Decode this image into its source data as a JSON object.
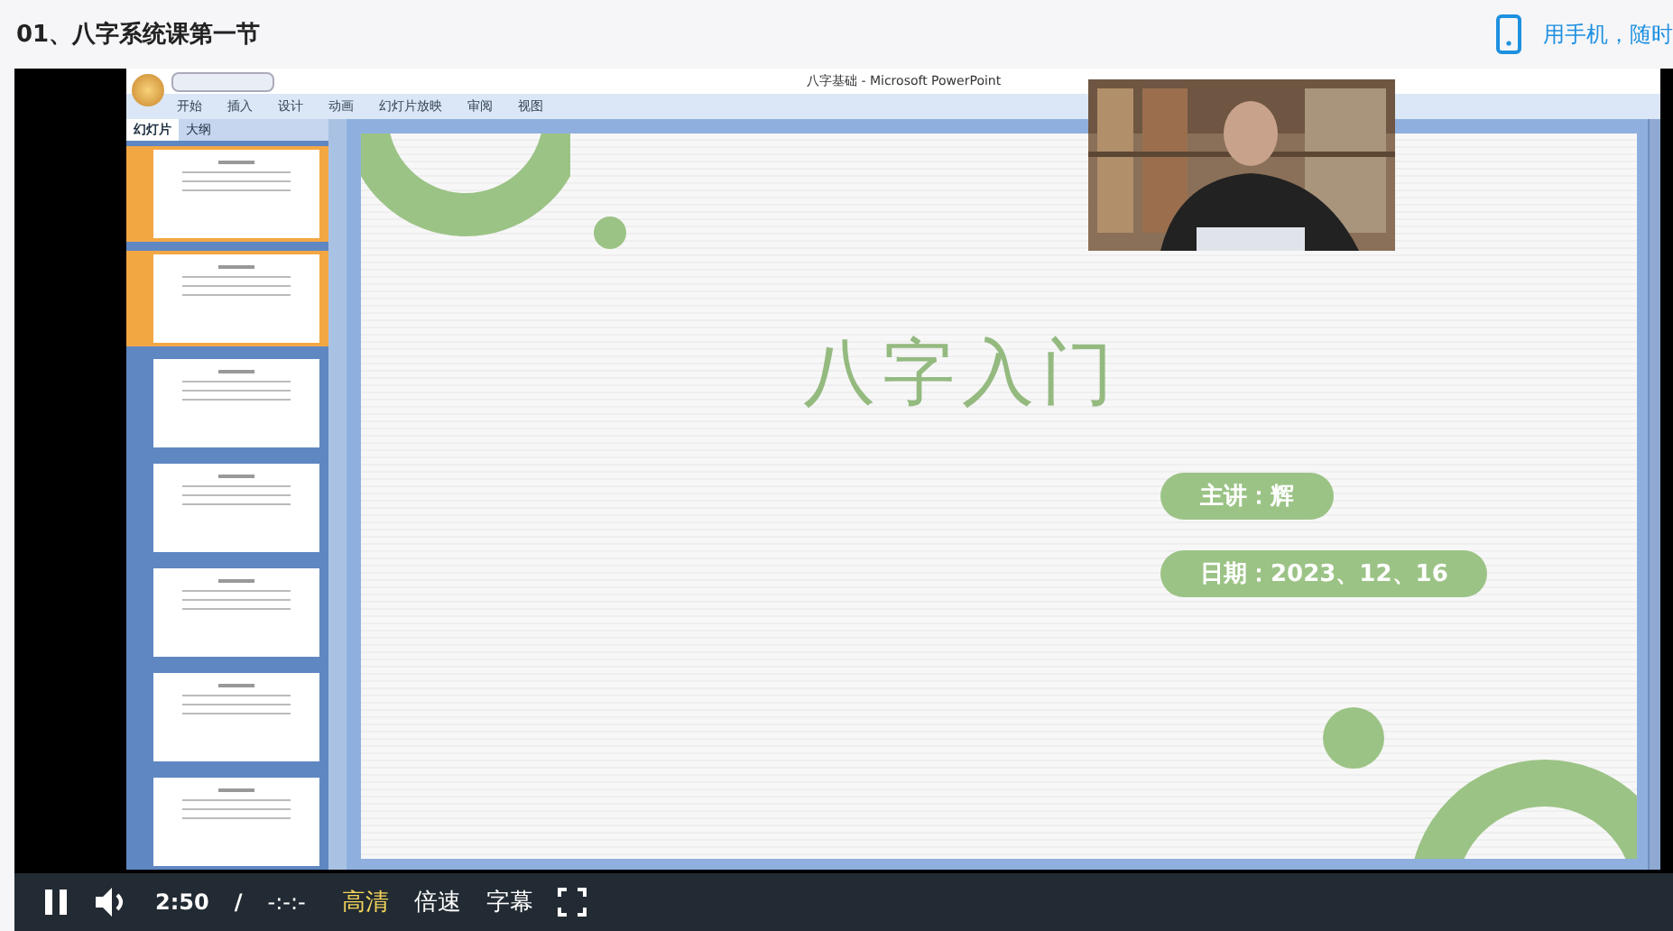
{
  "page_title": "01、八字系统课第一节",
  "mobile_link": "用手机，随时",
  "ppt": {
    "title": "八字基础 - Microsoft PowerPoint",
    "ribbon_tabs": [
      "开始",
      "插入",
      "设计",
      "动画",
      "幻灯片放映",
      "审阅",
      "视图"
    ],
    "panel_tabs": [
      {
        "label": "幻灯片",
        "selected": true
      },
      {
        "label": "大纲",
        "selected": false
      }
    ],
    "thumbnails": [
      {
        "selected": true
      },
      {
        "selected": true
      },
      {
        "selected": false
      },
      {
        "selected": false
      },
      {
        "selected": false
      },
      {
        "selected": false
      },
      {
        "selected": false
      }
    ]
  },
  "slide": {
    "title": "八字入门",
    "pills": [
      "主讲：辉",
      "日期：2023、12、16"
    ]
  },
  "player": {
    "playing": true,
    "elapsed": "2:50",
    "separator": "/",
    "duration": "-:-:-",
    "buttons": [
      {
        "label": "高清",
        "selected": true
      },
      {
        "label": "倍速",
        "selected": false
      },
      {
        "label": "字幕",
        "selected": false
      }
    ]
  }
}
